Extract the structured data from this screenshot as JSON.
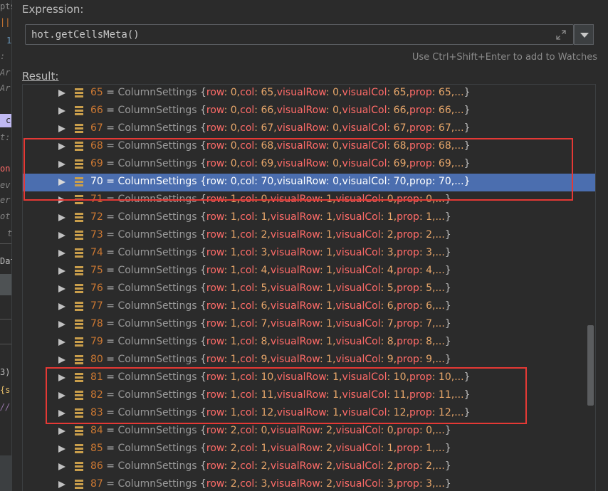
{
  "expression": {
    "label": "Expression:",
    "value": "hot.getCellsMeta()",
    "hint": "Use Ctrl+Shift+Enter to add to Watches"
  },
  "result": {
    "label": "Result:",
    "type_name": "ColumnSettings",
    "prop_keys": {
      "row": "row",
      "col": "col",
      "visualRow": "visualRow",
      "visualCol": "visualCol",
      "prop": "prop"
    },
    "ellipsis": "...",
    "selected_index": "70",
    "rows": [
      {
        "index": "65",
        "row": "0",
        "col": "65",
        "visualRow": "0",
        "visualCol": "65",
        "prop": "65"
      },
      {
        "index": "66",
        "row": "0",
        "col": "66",
        "visualRow": "0",
        "visualCol": "66",
        "prop": "66"
      },
      {
        "index": "67",
        "row": "0",
        "col": "67",
        "visualRow": "0",
        "visualCol": "67",
        "prop": "67"
      },
      {
        "index": "68",
        "row": "0",
        "col": "68",
        "visualRow": "0",
        "visualCol": "68",
        "prop": "68"
      },
      {
        "index": "69",
        "row": "0",
        "col": "69",
        "visualRow": "0",
        "visualCol": "69",
        "prop": "69"
      },
      {
        "index": "70",
        "row": "0",
        "col": "70",
        "visualRow": "0",
        "visualCol": "70",
        "prop": "70"
      },
      {
        "index": "71",
        "row": "1",
        "col": "0",
        "visualRow": "1",
        "visualCol": "0",
        "prop": "0"
      },
      {
        "index": "72",
        "row": "1",
        "col": "1",
        "visualRow": "1",
        "visualCol": "1",
        "prop": "1"
      },
      {
        "index": "73",
        "row": "1",
        "col": "2",
        "visualRow": "1",
        "visualCol": "2",
        "prop": "2"
      },
      {
        "index": "74",
        "row": "1",
        "col": "3",
        "visualRow": "1",
        "visualCol": "3",
        "prop": "3"
      },
      {
        "index": "75",
        "row": "1",
        "col": "4",
        "visualRow": "1",
        "visualCol": "4",
        "prop": "4"
      },
      {
        "index": "76",
        "row": "1",
        "col": "5",
        "visualRow": "1",
        "visualCol": "5",
        "prop": "5"
      },
      {
        "index": "77",
        "row": "1",
        "col": "6",
        "visualRow": "1",
        "visualCol": "6",
        "prop": "6"
      },
      {
        "index": "78",
        "row": "1",
        "col": "7",
        "visualRow": "1",
        "visualCol": "7",
        "prop": "7"
      },
      {
        "index": "79",
        "row": "1",
        "col": "8",
        "visualRow": "1",
        "visualCol": "8",
        "prop": "8"
      },
      {
        "index": "80",
        "row": "1",
        "col": "9",
        "visualRow": "1",
        "visualCol": "9",
        "prop": "9"
      },
      {
        "index": "81",
        "row": "1",
        "col": "10",
        "visualRow": "1",
        "visualCol": "10",
        "prop": "10"
      },
      {
        "index": "82",
        "row": "1",
        "col": "11",
        "visualRow": "1",
        "visualCol": "11",
        "prop": "11"
      },
      {
        "index": "83",
        "row": "1",
        "col": "12",
        "visualRow": "1",
        "visualCol": "12",
        "prop": "12"
      },
      {
        "index": "84",
        "row": "2",
        "col": "0",
        "visualRow": "2",
        "visualCol": "0",
        "prop": "0"
      },
      {
        "index": "85",
        "row": "2",
        "col": "1",
        "visualRow": "2",
        "visualCol": "1",
        "prop": "1"
      },
      {
        "index": "86",
        "row": "2",
        "col": "2",
        "visualRow": "2",
        "visualCol": "2",
        "prop": "2"
      },
      {
        "index": "87",
        "row": "2",
        "col": "3",
        "visualRow": "2",
        "visualCol": "3",
        "prop": "3"
      }
    ]
  },
  "annotation_boxes": [
    {
      "covers_rows": [
        "68",
        "69",
        "70"
      ],
      "color": "#e53935"
    },
    {
      "covers_rows": [
        "81",
        "82",
        "83"
      ],
      "color": "#e53935"
    }
  ],
  "left_fragments": [
    "pts:",
    "||",
    "1",
    ":",
    "Ar",
    "Ar",
    "c",
    "t:",
    "on",
    "ev",
    "er",
    "ot",
    "t",
    "Dat",
    "3)",
    "{s",
    "//"
  ],
  "colors": {
    "background": "#2b2b2b",
    "selected_row": "#4b6eaf",
    "annotation": "#e53935",
    "index_key": "#cc7832",
    "prop_key": "#ff6b68",
    "prop_value": "#e8a76a"
  },
  "icons": {
    "expand": "expand-arrows-icon",
    "dropdown": "chevron-down-icon",
    "row_toggle": "triangle-right-icon",
    "field": "field-icon"
  }
}
